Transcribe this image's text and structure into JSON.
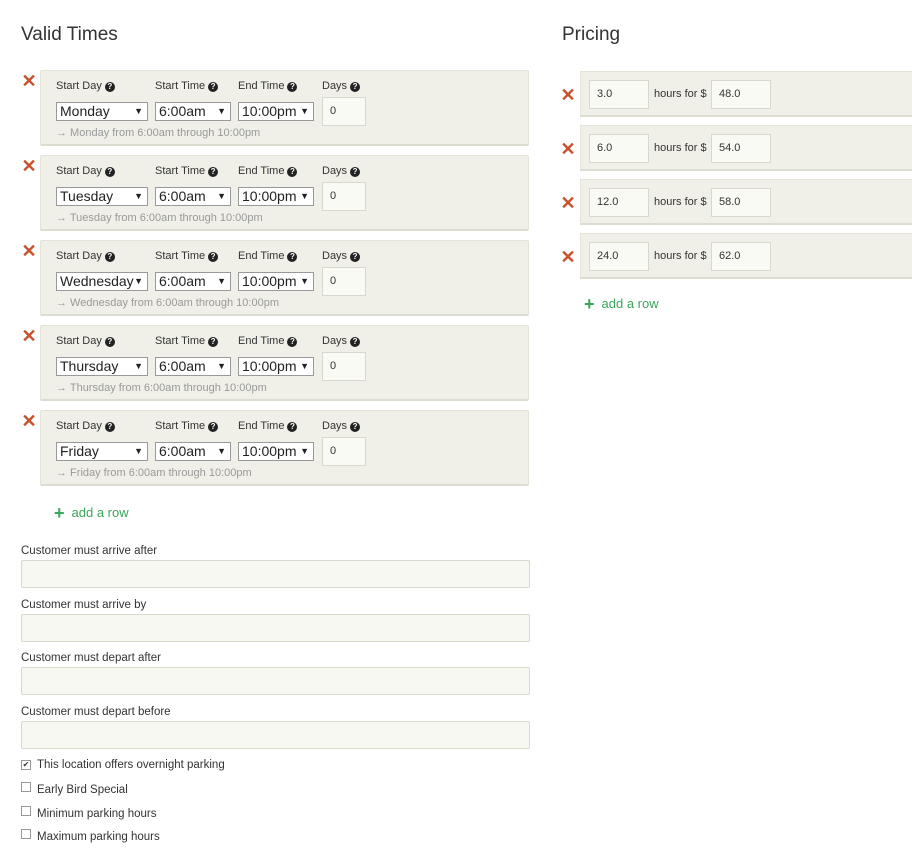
{
  "valid_times": {
    "title": "Valid Times",
    "labels": {
      "start_day": "Start Day",
      "start_time": "Start Time",
      "end_time": "End Time",
      "days": "Days"
    },
    "help_glyph": "?",
    "delete_glyph": "✕",
    "dropdown_glyph": "▼",
    "rows": [
      {
        "start_day": "Monday",
        "start_time": "6:00am",
        "end_time": "10:00pm",
        "days": "0",
        "summary": "→ Monday from 6:00am through 10:00pm"
      },
      {
        "start_day": "Tuesday",
        "start_time": "6:00am",
        "end_time": "10:00pm",
        "days": "0",
        "summary": "→ Tuesday from 6:00am through 10:00pm"
      },
      {
        "start_day": "Wednesday",
        "start_time": "6:00am",
        "end_time": "10:00pm",
        "days": "0",
        "summary": "→ Wednesday from 6:00am through 10:00pm"
      },
      {
        "start_day": "Thursday",
        "start_time": "6:00am",
        "end_time": "10:00pm",
        "days": "0",
        "summary": "→ Thursday from 6:00am through 10:00pm"
      },
      {
        "start_day": "Friday",
        "start_time": "6:00am",
        "end_time": "10:00pm",
        "days": "0",
        "summary": "→ Friday from 6:00am through 10:00pm"
      }
    ],
    "add_row": "add a row"
  },
  "constraints": [
    {
      "label": "Customer must arrive after",
      "value": ""
    },
    {
      "label": "Customer must arrive by",
      "value": ""
    },
    {
      "label": "Customer must depart after",
      "value": ""
    },
    {
      "label": "Customer must depart before",
      "value": ""
    }
  ],
  "options": [
    {
      "label": "This location offers overnight parking",
      "checked": true
    },
    {
      "label": "Early Bird Special",
      "checked": false
    },
    {
      "label": "Minimum parking hours",
      "checked": false
    },
    {
      "label": "Maximum parking hours",
      "checked": false
    }
  ],
  "check_glyph": "✔",
  "pricing": {
    "title": "Pricing",
    "hours_label": "hours for $",
    "rows": [
      {
        "hours": "3.0",
        "price": "48.0"
      },
      {
        "hours": "6.0",
        "price": "54.0"
      },
      {
        "hours": "12.0",
        "price": "58.0"
      },
      {
        "hours": "24.0",
        "price": "62.0"
      }
    ],
    "add_row": "add a row",
    "plus_glyph": "+"
  },
  "colors": {
    "accent_green": "#3aa55c",
    "delete_red": "#c8512b",
    "panel_bg": "#f0f0e8"
  }
}
